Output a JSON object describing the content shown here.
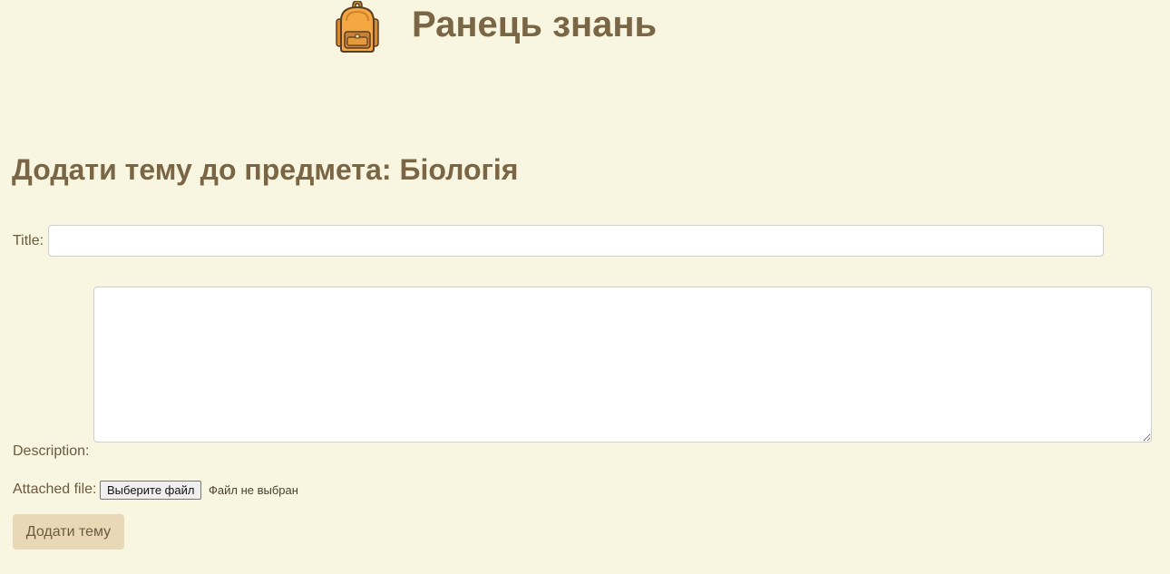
{
  "header": {
    "logo_icon": "backpack-icon",
    "site_title": "Ранець знань"
  },
  "page": {
    "title": "Додати тему до предмета: Біологія"
  },
  "form": {
    "title_label": "Title:",
    "title_value": "",
    "description_label": "Description:",
    "description_value": "",
    "file_label": "Attached file:",
    "file_button_label": "Выберите файл",
    "file_status": "Файл не выбран",
    "submit_label": "Додати тему"
  },
  "colors": {
    "background": "#f8f6e0",
    "heading": "#7a6645",
    "button_bg": "#e9d8b6",
    "backpack_main": "#f5a742",
    "backpack_outline": "#5a3e22"
  }
}
